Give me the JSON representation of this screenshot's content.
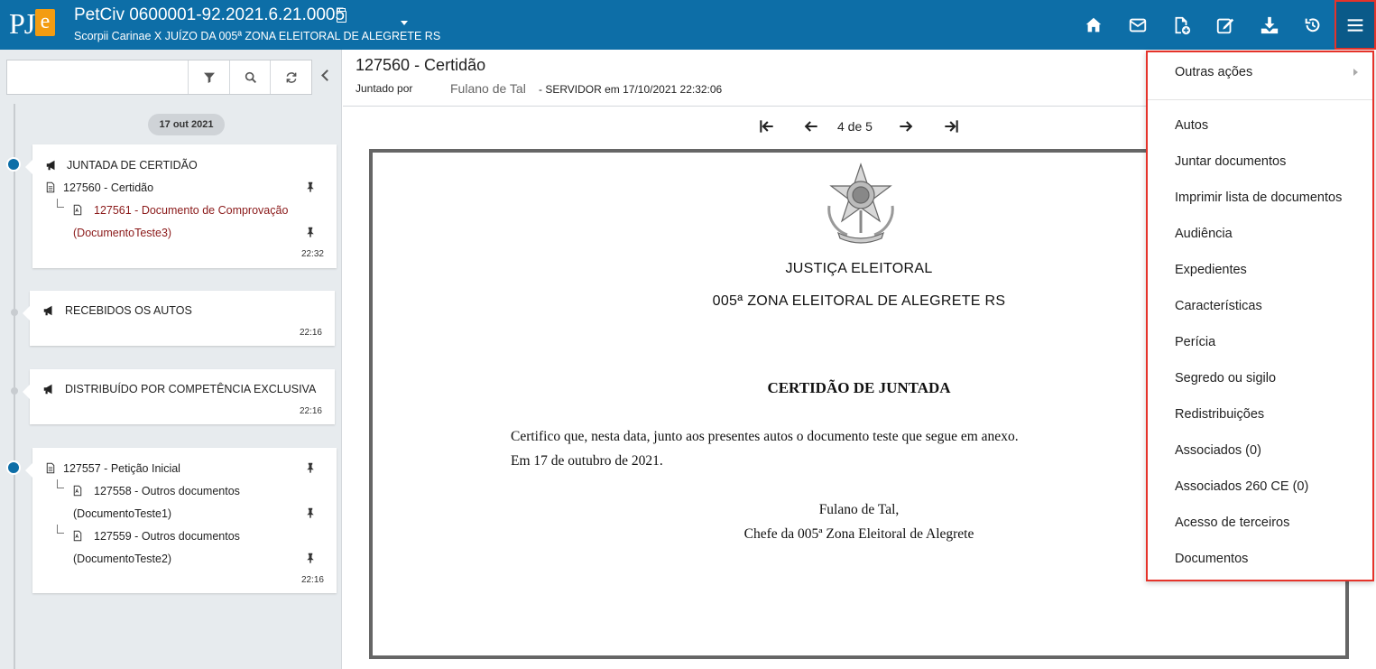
{
  "header": {
    "logo_text": "PJe",
    "process_title": "PetCiv 0600001-92.2021.6.21.0005",
    "process_subtitle": "Scorpii Carinae X JUÍZO DA 005ª ZONA ELEITORAL DE ALEGRETE RS",
    "icons": [
      "home-icon",
      "mail-icon",
      "new-document-icon",
      "edit-icon",
      "download-icon",
      "history-icon",
      "menu-icon"
    ]
  },
  "search": {
    "placeholder": "",
    "value": ""
  },
  "timeline": {
    "date": "17 out 2021",
    "events": [
      {
        "title": "JUNTADA DE CERTIDÃO",
        "doc": "127560 - Certidão",
        "sub_doc_line1": "127561 - Documento de Comprovação",
        "sub_doc_line2": "(DocumentoTeste3)",
        "time": "22:32"
      },
      {
        "title": "RECEBIDOS OS AUTOS",
        "time": "22:16"
      },
      {
        "title": "DISTRIBUÍDO POR COMPETÊNCIA EXCLUSIVA",
        "time": "22:16"
      },
      {
        "doc": "127557 - Petição Inicial",
        "sub1_line1": "127558 - Outros documentos",
        "sub1_line2": "(DocumentoTeste1)",
        "sub2_line1": "127559 - Outros documentos",
        "sub2_line2": "(DocumentoTeste2)",
        "time": "22:16"
      }
    ]
  },
  "document": {
    "title": "127560 - Certidão",
    "joined_by_label": "Juntado por",
    "joined_by_name": "Fulano de Tal",
    "joined_by_info": "- SERVIDOR em 17/10/2021 22:32:06",
    "page_indicator": "4 de 5",
    "org_line1": "JUSTIÇA ELEITORAL",
    "org_line2": "005ª ZONA ELEITORAL DE ALEGRETE RS",
    "heading": "CERTIDÃO DE JUNTADA",
    "body_line1": "Certifico que, nesta data, junto aos presentes autos o documento teste que segue em anexo.",
    "body_line2": "Em 17 de outubro de 2021.",
    "signature_name": "Fulano de Tal,",
    "signature_role": "Chefe da 005ª Zona Eleitoral de Alegrete"
  },
  "menu": {
    "top_item": "Outras ações",
    "items": [
      "Autos",
      "Juntar documentos",
      "Imprimir lista de documentos",
      "Audiência",
      "Expedientes",
      "Características",
      "Perícia",
      "Segredo ou sigilo",
      "Redistribuições",
      "Associados (0)",
      "Associados 260 CE (0)",
      "Acesso de terceiros",
      "Documentos"
    ]
  },
  "colors": {
    "header_bg": "#0d6ea7",
    "highlight_border": "#e5332a",
    "logo_accent": "#f39c12",
    "attachment_text": "#8b1a1a"
  }
}
